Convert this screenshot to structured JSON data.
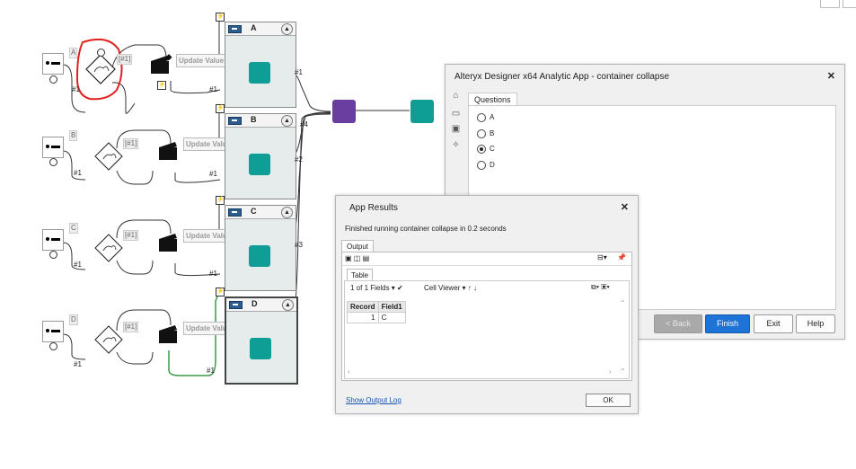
{
  "workflow": {
    "containers": [
      {
        "label": "A",
        "anchor": "#1"
      },
      {
        "label": "B",
        "anchor": "#2"
      },
      {
        "label": "C",
        "anchor": "#3"
      },
      {
        "label": "D",
        "anchor": "#4"
      }
    ],
    "rows": [
      {
        "tag": "A",
        "formula_tag": "[#1]",
        "update_label": "Update Value",
        "anchor_in": "#1",
        "anchor_out": "#1"
      },
      {
        "tag": "B",
        "formula_tag": "[#1]",
        "update_label": "Update Value",
        "anchor_in": "#1",
        "anchor_out": "#1"
      },
      {
        "tag": "C",
        "formula_tag": "[#1]",
        "update_label": "Update Value",
        "anchor_in": "#1",
        "anchor_out": "#1"
      },
      {
        "tag": "D",
        "formula_tag": "[#1]",
        "update_label": "Update Value",
        "anchor_in": "#1",
        "anchor_out": "#1"
      }
    ],
    "union_anchor": "#4",
    "colors": {
      "teal": "#0f9e95",
      "purple": "#6a3ea1",
      "green_wire": "#3c9a4a",
      "red_annotation": "#e0201c"
    }
  },
  "app_window": {
    "title": "Alteryx Designer x64 Analytic App - container collapse",
    "tab_label": "Questions",
    "options": [
      {
        "label": "A",
        "selected": false
      },
      {
        "label": "B",
        "selected": false
      },
      {
        "label": "C",
        "selected": true
      },
      {
        "label": "D",
        "selected": false
      }
    ],
    "buttons": {
      "back": "< Back",
      "finish": "Finish",
      "exit": "Exit",
      "help": "Help"
    }
  },
  "results": {
    "title": "App Results",
    "message": "Finished running container collapse in 0.2 seconds",
    "output_tab": "Output",
    "table_tab": "Table",
    "fields_label": "1 of 1 Fields",
    "viewer_label": "Cell Viewer",
    "columns": [
      "Record",
      "Field1"
    ],
    "rows": [
      [
        "1",
        "C"
      ]
    ],
    "log_link": "Show Output Log",
    "ok": "OK"
  }
}
